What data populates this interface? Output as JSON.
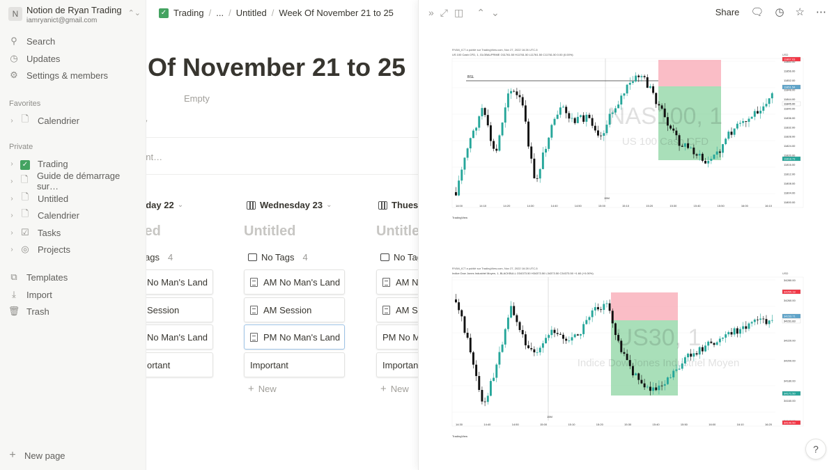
{
  "workspace": {
    "badge": "N",
    "name": "Notion de Ryan Trading",
    "email": "iamryanict@gmail.com"
  },
  "sidebar": {
    "top": [
      {
        "label": "Search",
        "icon": "search-icon"
      },
      {
        "label": "Updates",
        "icon": "clock-icon"
      },
      {
        "label": "Settings & members",
        "icon": "gear-icon"
      }
    ],
    "favorites_label": "Favorites",
    "favorites": [
      {
        "label": "Calendrier",
        "icon": "page-icon"
      }
    ],
    "private_label": "Private",
    "private": [
      {
        "label": "Trading",
        "icon": "trading-icon"
      },
      {
        "label": "Guide de démarrage sur…",
        "icon": "page-icon"
      },
      {
        "label": "Untitled",
        "icon": "page-icon"
      },
      {
        "label": "Calendrier",
        "icon": "page-icon"
      },
      {
        "label": "Tasks",
        "icon": "checkbox-icon"
      },
      {
        "label": "Projects",
        "icon": "target-icon"
      }
    ],
    "bottom": [
      {
        "label": "Templates",
        "icon": "templates-icon"
      },
      {
        "label": "Import",
        "icon": "download-icon"
      },
      {
        "label": "Trash",
        "icon": "trash-icon"
      }
    ],
    "new_page": "New page"
  },
  "breadcrumb": {
    "trading": "Trading",
    "ellipsis": "...",
    "untitled": "Untitled",
    "current": "Week Of November 21 to 25"
  },
  "page": {
    "title": "Of November 21 to 25",
    "property_empty": "Empty",
    "property_fragment": "ty",
    "comment_fragment": "ent…"
  },
  "board": {
    "columns": [
      {
        "header": "sday 22",
        "title": "led",
        "group": "ags",
        "count": "4",
        "cards": [
          "No Man's Land",
          "Session",
          "No Man's Land",
          "ortant"
        ]
      },
      {
        "header": "Wednesday 23",
        "title": "Untitled",
        "group": "No Tags",
        "count": "4",
        "cards": [
          "AM No Man's Land",
          "AM Session",
          "PM No Man's Land",
          "Important"
        ]
      },
      {
        "header": "Thues",
        "title": "Untitle",
        "group": "No Tag",
        "count": "",
        "cards": [
          "AM N",
          "AM S",
          "PM No M",
          "Important"
        ]
      }
    ],
    "new_label": "New"
  },
  "peek": {
    "share_label": "Share",
    "help_label": "?"
  },
  "charts": [
    {
      "header": "RYAN_ICT a publié sur TradingView.com, Nov 27, 2022 16:26 UTC-5",
      "info": "US 100 Cash CFD, 1, GLOBALPRIME  O11761.50 H11761.50 L11761.50 C11761.50 0.00 (0.00%)",
      "watermark_main": "NAS100, 1",
      "watermark_sub": "US 100 Cash CFD",
      "currency": "USD",
      "bsl_label": "BSL",
      "time_labels": [
        "14:00",
        "14:10",
        "14:20",
        "14:30",
        "14:40",
        "14:50",
        "15:00",
        "15:10",
        "15:20",
        "15:30",
        "15:40",
        "15:50",
        "16:00",
        "16:10"
      ],
      "price_labels": [
        "11860.00",
        "11856.00",
        "11852.00",
        "11848.00",
        "11844.00",
        "11840.00",
        "11836.00",
        "11832.00",
        "11828.00",
        "11824.00",
        "11820.00",
        "11816.00",
        "11812.00",
        "11808.00",
        "11804.00",
        "11800.00"
      ],
      "badges": [
        {
          "text": "11867.03",
          "color": "#f23645"
        },
        {
          "text": "11851.54",
          "color": "#5da3c9"
        },
        {
          "text": "11845.00",
          "color": "#ffffff"
        },
        {
          "text": "11818.73",
          "color": "#26a69a"
        }
      ],
      "marker": "15M",
      "logo": "TradingView"
    },
    {
      "header": "RYAN_ICT a publié sur TradingView.com, Nov 27, 2022 16:28 UTC-5",
      "info": "Indice Dow Jones Industriel Moyen, 1, BLACKBULL  O34373.50 H34373.50 L34373.50 C34373.50 +1.60 (+0.00%)",
      "watermark_main": "US30, 1",
      "watermark_sub": "Indice Dow Jones Industriel Moyen",
      "currency": "USD",
      "bsl_label": "",
      "time_labels": [
        "14:30",
        "14:40",
        "14:50",
        "15:00",
        "15:10",
        "15:20",
        "15:30",
        "15:40",
        "15:50",
        "16:00",
        "16:10",
        "16:20"
      ],
      "price_labels": [
        "34280.00",
        "34260.00",
        "34240.00",
        "34220.00",
        "34200.00",
        "34180.00",
        "34160.00",
        "34140.00"
      ],
      "badges": [
        {
          "text": "34255.18",
          "color": "#f23645"
        },
        {
          "text": "34233.71",
          "color": "#5da3c9"
        },
        {
          "text": "34231.83",
          "color": "#ffffff"
        },
        {
          "text": "34171.50",
          "color": "#26a69a"
        },
        {
          "text": "34140.50",
          "color": "#f23645"
        }
      ],
      "marker": "15M",
      "logo": "TradingView"
    }
  ]
}
